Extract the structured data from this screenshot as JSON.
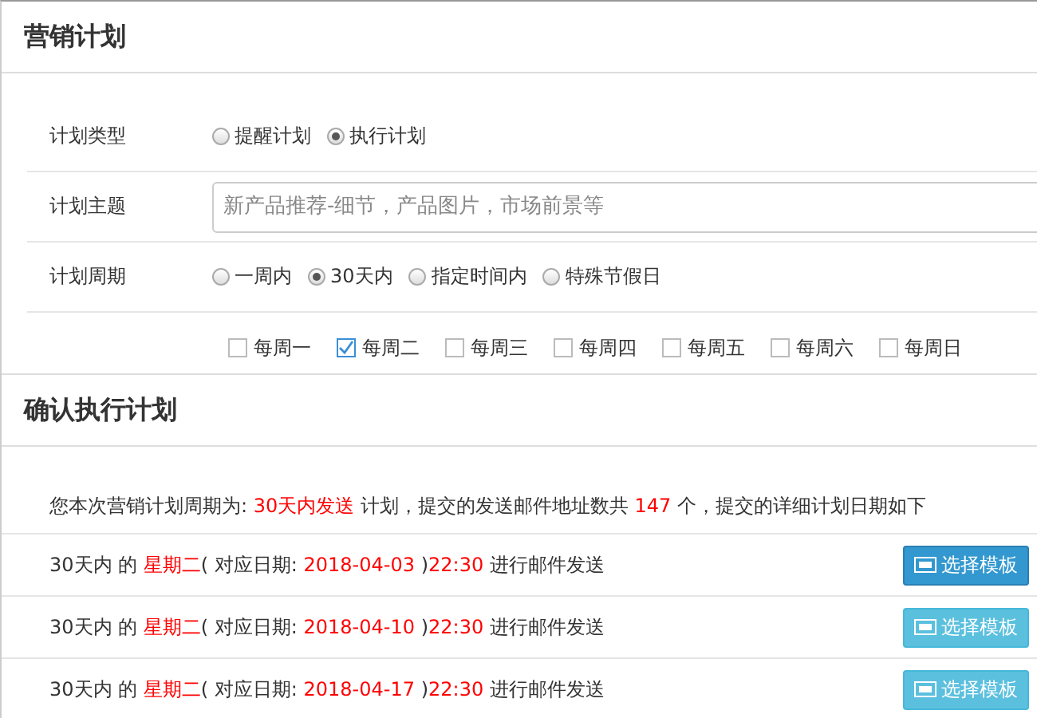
{
  "plan_section": {
    "title": "营销计划",
    "plan_type": {
      "label": "计划类型",
      "options": [
        {
          "label": "提醒计划",
          "selected": false
        },
        {
          "label": "执行计划",
          "selected": true
        }
      ]
    },
    "plan_subject": {
      "label": "计划主题",
      "placeholder": "新产品推荐-细节，产品图片，市场前景等"
    },
    "plan_period": {
      "label": "计划周期",
      "options": [
        {
          "label": "一周内",
          "selected": false
        },
        {
          "label": "30天内",
          "selected": true
        },
        {
          "label": "指定时间内",
          "selected": false
        },
        {
          "label": "特殊节假日",
          "selected": false
        }
      ]
    },
    "weekdays": [
      {
        "label": "每周一",
        "checked": false
      },
      {
        "label": "每周二",
        "checked": true
      },
      {
        "label": "每周三",
        "checked": false
      },
      {
        "label": "每周四",
        "checked": false
      },
      {
        "label": "每周五",
        "checked": false
      },
      {
        "label": "每周六",
        "checked": false
      },
      {
        "label": "每周日",
        "checked": false
      }
    ]
  },
  "confirm_section": {
    "title": "确认执行计划",
    "summary": [
      {
        "text": "您本次营销计划周期为: ",
        "highlight": false
      },
      {
        "text": "30天内发送",
        "highlight": true
      },
      {
        "text": " 计划，提交的发送邮件地址数共 ",
        "highlight": false
      },
      {
        "text": "147",
        "highlight": true
      },
      {
        "text": " 个，提交的详细计划日期如下",
        "highlight": false
      }
    ],
    "schedule": [
      {
        "parts": [
          {
            "text": "30天内 的 ",
            "highlight": false
          },
          {
            "text": "星期二",
            "highlight": true
          },
          {
            "text": "( 对应日期: ",
            "highlight": false
          },
          {
            "text": "2018-04-03",
            "highlight": true
          },
          {
            "text": " )",
            "highlight": false
          },
          {
            "text": "22:30",
            "highlight": true
          },
          {
            "text": " 进行邮件发送",
            "highlight": false
          }
        ],
        "button": "选择模板",
        "selected": true
      },
      {
        "parts": [
          {
            "text": "30天内 的 ",
            "highlight": false
          },
          {
            "text": "星期二",
            "highlight": true
          },
          {
            "text": "( 对应日期: ",
            "highlight": false
          },
          {
            "text": "2018-04-10",
            "highlight": true
          },
          {
            "text": " )",
            "highlight": false
          },
          {
            "text": "22:30",
            "highlight": true
          },
          {
            "text": " 进行邮件发送",
            "highlight": false
          }
        ],
        "button": "选择模板",
        "selected": false
      },
      {
        "parts": [
          {
            "text": "30天内 的 ",
            "highlight": false
          },
          {
            "text": "星期二",
            "highlight": true
          },
          {
            "text": "( 对应日期: ",
            "highlight": false
          },
          {
            "text": "2018-04-17",
            "highlight": true
          },
          {
            "text": " )",
            "highlight": false
          },
          {
            "text": "22:30",
            "highlight": true
          },
          {
            "text": " 进行邮件发送",
            "highlight": false
          }
        ],
        "button": "选择模板",
        "selected": false
      }
    ]
  }
}
